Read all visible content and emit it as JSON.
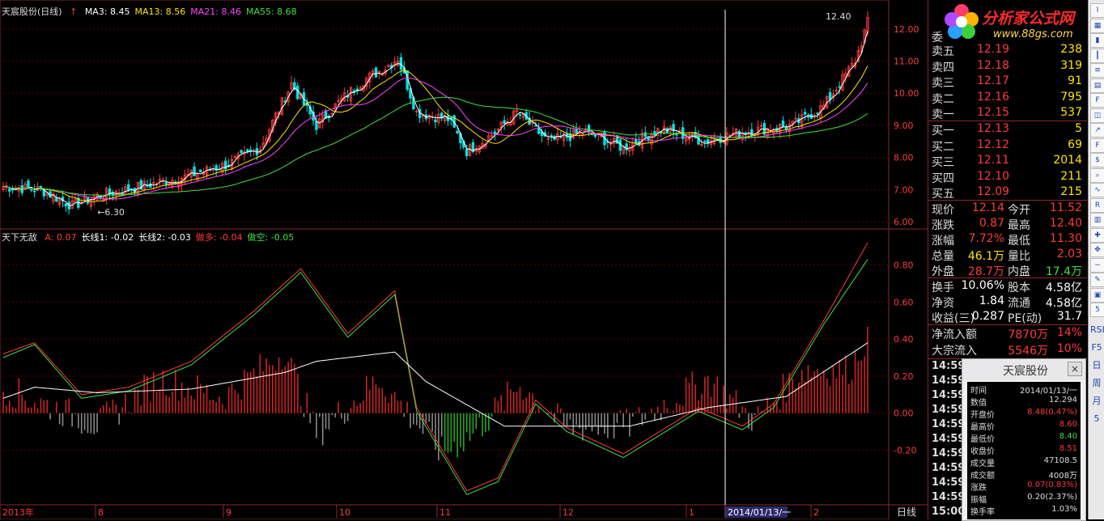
{
  "main_title": "天宸股份(日线)",
  "ma_legend": [
    {
      "label": "MA3: 8.45",
      "color": "#ffffff"
    },
    {
      "label": "MA13: 8.56",
      "color": "#ffe400"
    },
    {
      "label": "MA21: 8.46",
      "color": "#ff44ff"
    },
    {
      "label": "MA55: 8.68",
      "color": "#44dd44"
    }
  ],
  "sub_title": "天下无敌",
  "sub_legend": [
    {
      "label": "A: 0.07",
      "color": "#ff3b3b"
    },
    {
      "label": "长线1: -0.02",
      "color": "#ffffff"
    },
    {
      "label": "长线2: -0.03",
      "color": "#ffffff"
    },
    {
      "label": "做多: -0.04",
      "color": "#ff3b3b"
    },
    {
      "label": "做空: -0.05",
      "color": "#44dd44"
    }
  ],
  "price_axis_labels": [
    "12.00",
    "11.00",
    "10.00",
    "9.00",
    "8.00",
    "7.00",
    "6.00"
  ],
  "osc_axis_labels": [
    "0.80",
    "0.60",
    "0.40",
    "0.20",
    "0.00",
    "-0.20"
  ],
  "x_axis_labels": [
    "2013年",
    "8",
    "9",
    "10",
    "11",
    "12",
    "1",
    "2014/01/13/一",
    "2"
  ],
  "period_label": "日线",
  "annotations": {
    "high": "12.40",
    "low": "6.30"
  },
  "colors": {
    "up": "#ff3b3b",
    "down": "#00e5e5",
    "ma3": "#ffffff",
    "ma13": "#ffe400",
    "ma21": "#ff44ff",
    "ma55": "#44dd44",
    "grid": "#5a0000"
  },
  "chart_data": [
    {
      "type": "candlestick",
      "title": "天宸股份(日线)",
      "x_range": [
        "2013-07",
        "2014-02"
      ],
      "y_range": [
        5.8,
        12.6
      ],
      "grid": true,
      "close_anchors": [
        {
          "i": 0,
          "v": 7.1
        },
        {
          "i": 12,
          "v": 7.0
        },
        {
          "i": 22,
          "v": 6.5
        },
        {
          "i": 30,
          "v": 6.8
        },
        {
          "i": 44,
          "v": 7.1
        },
        {
          "i": 58,
          "v": 7.4
        },
        {
          "i": 72,
          "v": 7.8
        },
        {
          "i": 82,
          "v": 8.3
        },
        {
          "i": 92,
          "v": 10.3
        },
        {
          "i": 100,
          "v": 9.0
        },
        {
          "i": 108,
          "v": 9.8
        },
        {
          "i": 115,
          "v": 10.4
        },
        {
          "i": 122,
          "v": 10.8
        },
        {
          "i": 126,
          "v": 11.1
        },
        {
          "i": 132,
          "v": 9.4
        },
        {
          "i": 142,
          "v": 9.2
        },
        {
          "i": 148,
          "v": 8.2
        },
        {
          "i": 156,
          "v": 8.7
        },
        {
          "i": 164,
          "v": 9.4
        },
        {
          "i": 174,
          "v": 8.5
        },
        {
          "i": 186,
          "v": 8.8
        },
        {
          "i": 198,
          "v": 8.3
        },
        {
          "i": 210,
          "v": 8.9
        },
        {
          "i": 224,
          "v": 8.5
        },
        {
          "i": 236,
          "v": 8.8
        },
        {
          "i": 252,
          "v": 9.0
        },
        {
          "i": 262,
          "v": 9.6
        },
        {
          "i": 272,
          "v": 11.0
        },
        {
          "i": 276,
          "v": 12.2
        }
      ],
      "ma_last": {
        "MA3": 8.45,
        "MA13": 8.56,
        "MA21": 8.46,
        "MA55": 8.68
      },
      "high": 12.4,
      "low": 6.3
    },
    {
      "type": "line+bar",
      "title": "天下无敌",
      "y_range": [
        -0.46,
        0.92
      ],
      "series": [
        {
          "name": "做多",
          "color": "#ff3b3b",
          "anchors": [
            {
              "i": 0,
              "v": 0.32
            },
            {
              "i": 10,
              "v": 0.38
            },
            {
              "i": 25,
              "v": 0.1
            },
            {
              "i": 40,
              "v": 0.14
            },
            {
              "i": 60,
              "v": 0.28
            },
            {
              "i": 80,
              "v": 0.55
            },
            {
              "i": 95,
              "v": 0.78
            },
            {
              "i": 110,
              "v": 0.43
            },
            {
              "i": 125,
              "v": 0.66
            },
            {
              "i": 132,
              "v": 0.03
            },
            {
              "i": 148,
              "v": -0.42
            },
            {
              "i": 158,
              "v": -0.35
            },
            {
              "i": 170,
              "v": 0.07
            },
            {
              "i": 180,
              "v": -0.08
            },
            {
              "i": 198,
              "v": -0.22
            },
            {
              "i": 222,
              "v": 0.03
            },
            {
              "i": 236,
              "v": -0.07
            },
            {
              "i": 246,
              "v": 0.05
            },
            {
              "i": 262,
              "v": 0.5
            },
            {
              "i": 276,
              "v": 0.92
            }
          ]
        },
        {
          "name": "做空",
          "color": "#44dd44",
          "anchors": [
            {
              "i": 0,
              "v": 0.3
            },
            {
              "i": 10,
              "v": 0.37
            },
            {
              "i": 25,
              "v": 0.08
            },
            {
              "i": 40,
              "v": 0.12
            },
            {
              "i": 60,
              "v": 0.26
            },
            {
              "i": 80,
              "v": 0.53
            },
            {
              "i": 95,
              "v": 0.76
            },
            {
              "i": 110,
              "v": 0.41
            },
            {
              "i": 125,
              "v": 0.64
            },
            {
              "i": 132,
              "v": 0.01
            },
            {
              "i": 148,
              "v": -0.44
            },
            {
              "i": 158,
              "v": -0.37
            },
            {
              "i": 170,
              "v": 0.05
            },
            {
              "i": 180,
              "v": -0.1
            },
            {
              "i": 198,
              "v": -0.24
            },
            {
              "i": 222,
              "v": 0.01
            },
            {
              "i": 236,
              "v": -0.09
            },
            {
              "i": 246,
              "v": 0.03
            },
            {
              "i": 262,
              "v": 0.48
            },
            {
              "i": 276,
              "v": 0.83
            }
          ]
        },
        {
          "name": "长线1",
          "color": "#ffffff",
          "anchors": [
            {
              "i": 0,
              "v": 0.08
            },
            {
              "i": 10,
              "v": 0.14
            },
            {
              "i": 30,
              "v": 0.11
            },
            {
              "i": 60,
              "v": 0.13
            },
            {
              "i": 90,
              "v": 0.22
            },
            {
              "i": 100,
              "v": 0.28
            },
            {
              "i": 125,
              "v": 0.33
            },
            {
              "i": 135,
              "v": 0.17
            },
            {
              "i": 160,
              "v": -0.07
            },
            {
              "i": 200,
              "v": -0.07
            },
            {
              "i": 225,
              "v": 0.03
            },
            {
              "i": 250,
              "v": 0.09
            },
            {
              "i": 276,
              "v": 0.38
            }
          ]
        }
      ],
      "bar_anchors": [
        {
          "i": 0,
          "v": 0.1
        },
        {
          "i": 30,
          "v": -0.1
        },
        {
          "i": 50,
          "v": 0.15
        },
        {
          "i": 70,
          "v": 0.05
        },
        {
          "i": 90,
          "v": 0.3
        },
        {
          "i": 100,
          "v": -0.15
        },
        {
          "i": 120,
          "v": 0.15
        },
        {
          "i": 140,
          "v": -0.25
        },
        {
          "i": 150,
          "v": -0.15
        },
        {
          "i": 165,
          "v": 0.12
        },
        {
          "i": 180,
          "v": -0.12
        },
        {
          "i": 200,
          "v": -0.1
        },
        {
          "i": 225,
          "v": 0.15
        },
        {
          "i": 240,
          "v": -0.08
        },
        {
          "i": 255,
          "v": 0.2
        },
        {
          "i": 270,
          "v": 0.2
        },
        {
          "i": 276,
          "v": 0.38
        }
      ]
    }
  ],
  "order_book": {
    "partial_label": "委",
    "sells": [
      {
        "label": "卖五",
        "price": "12.19",
        "vol": "238"
      },
      {
        "label": "卖四",
        "price": "12.18",
        "vol": "319"
      },
      {
        "label": "卖三",
        "price": "12.17",
        "vol": "91"
      },
      {
        "label": "卖二",
        "price": "12.16",
        "vol": "795"
      },
      {
        "label": "卖一",
        "price": "12.15",
        "vol": "537"
      }
    ],
    "buys": [
      {
        "label": "买一",
        "price": "12.13",
        "vol": "5"
      },
      {
        "label": "买二",
        "price": "12.12",
        "vol": "69"
      },
      {
        "label": "买三",
        "price": "12.11",
        "vol": "2014"
      },
      {
        "label": "买四",
        "price": "12.10",
        "vol": "211"
      },
      {
        "label": "买五",
        "price": "12.09",
        "vol": "215"
      }
    ]
  },
  "stats": [
    {
      "l1": "现价",
      "v1": "12.14",
      "c1": "#ff3b3b",
      "l2": "今开",
      "v2": "11.52",
      "c2": "#ff3b3b"
    },
    {
      "l1": "涨跌",
      "v1": "0.87",
      "c1": "#ff3b3b",
      "l2": "最高",
      "v2": "12.40",
      "c2": "#ff3b3b"
    },
    {
      "l1": "涨幅",
      "v1": "7.72%",
      "c1": "#ff3b3b",
      "l2": "最低",
      "v2": "11.30",
      "c2": "#ff3b3b"
    },
    {
      "l1": "总量",
      "v1": "46.1万",
      "c1": "#ffe400",
      "l2": "量比",
      "v2": "2.03",
      "c2": "#ff3b3b"
    },
    {
      "l1": "外盘",
      "v1": "28.7万",
      "c1": "#ff3b3b",
      "l2": "内盘",
      "v2": "17.4万",
      "c2": "#44dd44"
    },
    {
      "l1": "换手",
      "v1": "10.06%",
      "c1": "#ffffff",
      "l2": "股本",
      "v2": "4.58亿",
      "c2": "#ffffff"
    },
    {
      "l1": "净资",
      "v1": "1.84",
      "c1": "#ffffff",
      "l2": "流通",
      "v2": "4.58亿",
      "c2": "#ffffff"
    },
    {
      "l1": "收益(三)",
      "v1": "0.287",
      "c1": "#ffffff",
      "l2": "PE(动)",
      "v2": "31.7",
      "c2": "#ffffff"
    }
  ],
  "flows": [
    {
      "label": "净流入额",
      "val": "7870万",
      "pct": "14%"
    },
    {
      "label": "大宗流入",
      "val": "5546万",
      "pct": "10%"
    }
  ],
  "ticks": [
    "14:59",
    "14:59",
    "14:59",
    "14:59",
    "14:59",
    "14:59",
    "14:59",
    "14:59",
    "14:59",
    "14:59",
    "15:00"
  ],
  "logo": {
    "name": "分析家公式网",
    "url": "www.88gs.com"
  },
  "toolbar_icons": [
    "line-chart-icon",
    "table-icon",
    "bar-icon",
    "kline-icon",
    "list-icon",
    "grid-icon",
    "f10-icon",
    "chart-icon",
    "rise-icon",
    "f10-icon",
    "fin-icon",
    "search-icon",
    "wave-icon",
    "rsi-icon",
    "stack-icon",
    "plus-icon",
    "move-icon",
    "minus-icon",
    "pen-icon",
    "doc-icon",
    "f5-icon"
  ],
  "toolbar_labels": [
    "RSI",
    "F5",
    "日",
    "周",
    "月",
    "5"
  ],
  "popup": {
    "title": "天宸股份",
    "close": "×",
    "rows": [
      {
        "label": "时间",
        "value": "2014/01/13/一",
        "color": "#dddddd"
      },
      {
        "label": "数值",
        "value": "12.294",
        "color": "#dddddd"
      },
      {
        "label": "开盘价",
        "value": "8.48(0.47%)",
        "color": "#ff3b3b"
      },
      {
        "label": "最高价",
        "value": "8.60",
        "color": "#ff3b3b"
      },
      {
        "label": "最低价",
        "value": "8.40",
        "color": "#44dd44"
      },
      {
        "label": "收盘价",
        "value": "8.51",
        "color": "#ff3b3b"
      },
      {
        "label": "成交量",
        "value": "47108.5",
        "color": "#dddddd"
      },
      {
        "label": "成交额",
        "value": "4008万",
        "color": "#dddddd"
      },
      {
        "label": "涨跌",
        "value": "0.07(0.83%)",
        "color": "#ff3b3b"
      },
      {
        "label": "振幅",
        "value": "0.20(2.37%)",
        "color": "#dddddd"
      },
      {
        "label": "换手率",
        "value": "1.03%",
        "color": "#dddddd"
      }
    ]
  }
}
